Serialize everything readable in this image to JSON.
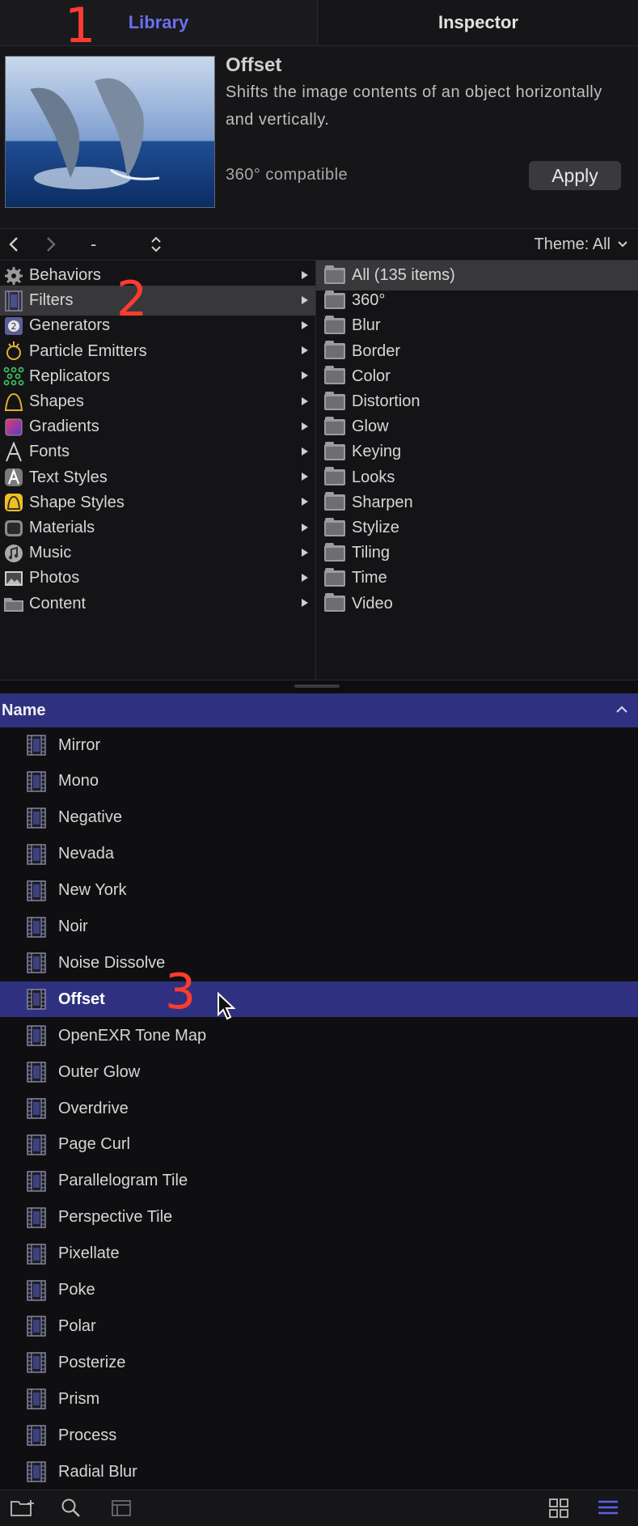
{
  "tabs": {
    "library": "Library",
    "inspector": "Inspector"
  },
  "preview": {
    "title": "Offset",
    "description": "Shifts the image contents of an object horizontally and vertically.",
    "compatibility": "360° compatible",
    "apply_label": "Apply"
  },
  "nav": {
    "back": "‹",
    "forward": "›",
    "dash": "-",
    "updown": "⇕",
    "theme_label": "Theme: All"
  },
  "categories": [
    {
      "label": "Behaviors",
      "icon": "gear-icon"
    },
    {
      "label": "Filters",
      "icon": "film-icon"
    },
    {
      "label": "Generators",
      "icon": "generator-icon"
    },
    {
      "label": "Particle Emitters",
      "icon": "particle-icon"
    },
    {
      "label": "Replicators",
      "icon": "replicator-icon"
    },
    {
      "label": "Shapes",
      "icon": "shape-icon"
    },
    {
      "label": "Gradients",
      "icon": "gradient-icon"
    },
    {
      "label": "Fonts",
      "icon": "font-icon"
    },
    {
      "label": "Text Styles",
      "icon": "text-style-icon"
    },
    {
      "label": "Shape Styles",
      "icon": "shape-style-icon"
    },
    {
      "label": "Materials",
      "icon": "material-icon"
    },
    {
      "label": "Music",
      "icon": "music-icon"
    },
    {
      "label": "Photos",
      "icon": "photo-icon"
    },
    {
      "label": "Content",
      "icon": "folder-icon"
    }
  ],
  "selected_category": "Filters",
  "subfolders": [
    "All (135 items)",
    "360°",
    "Blur",
    "Border",
    "Color",
    "Distortion",
    "Glow",
    "Keying",
    "Looks",
    "Sharpen",
    "Stylize",
    "Tiling",
    "Time",
    "Video"
  ],
  "selected_subfolder": "All (135 items)",
  "list": {
    "header": "Name",
    "items": [
      "Mirror",
      "Mono",
      "Negative",
      "Nevada",
      "New York",
      "Noir",
      "Noise Dissolve",
      "Offset",
      "OpenEXR Tone Map",
      "Outer Glow",
      "Overdrive",
      "Page Curl",
      "Parallelogram Tile",
      "Perspective Tile",
      "Pixellate",
      "Poke",
      "Polar",
      "Posterize",
      "Prism",
      "Process",
      "Radial Blur"
    ],
    "selected": "Offset"
  },
  "annotations": [
    "1",
    "2",
    "3"
  ],
  "colors": {
    "accent": "#2f3180",
    "tab_active": "#6b6ff0",
    "annotation": "#ff3b30"
  }
}
